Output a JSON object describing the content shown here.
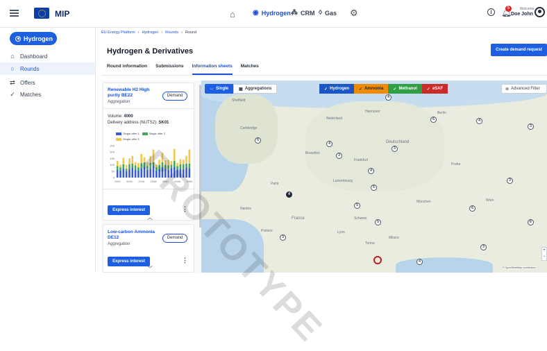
{
  "app": {
    "brand": "MIP"
  },
  "topnav": {
    "items": [
      {
        "label": "Hydrogen",
        "active": true
      },
      {
        "label": "CRM",
        "active": false
      },
      {
        "label": "Gas",
        "active": false
      }
    ],
    "notifications_count": "5",
    "welcome": "Welcome",
    "user_name": "Doe John"
  },
  "sidebar": {
    "sector": "Hydrogen",
    "items": [
      {
        "label": "Dashboard"
      },
      {
        "label": "Rounds"
      },
      {
        "label": "Offers"
      },
      {
        "label": "Matches"
      }
    ]
  },
  "breadcrumb": [
    "EU Energy Platform",
    "Hydrogen",
    "Rounds",
    "Round"
  ],
  "page": {
    "title": "Hydrogen & Derivatives",
    "create_button": "Create demand request",
    "tabs": [
      "Round information",
      "Submissions",
      "Information sheets",
      "Matches"
    ],
    "active_tab": "Information sheets"
  },
  "cards": [
    {
      "title": "Renewable H2 High purity BE22",
      "type": "Aggregation",
      "badge": "Demand",
      "volume_label": "Volume:",
      "volume_value": "4000",
      "delivery_label": "Delivery address (NUTS2):",
      "delivery_value": "SK01",
      "express_label": "Express interest"
    },
    {
      "title": "Low-carbon Ammonia DE12",
      "type": "Aggregation",
      "badge": "Demand",
      "express_label": "Express interest"
    }
  ],
  "chart_data": {
    "type": "bar",
    "stacked": true,
    "legend": [
      "Single offer 1",
      "Single offer 2",
      "Single offer 3"
    ],
    "colors": [
      "#3b5bd6",
      "#3fa85a",
      "#f2c94c"
    ],
    "x_tick_labels": [
      "2026",
      "2030",
      "2034",
      "2038",
      "2042",
      "2046",
      "2050"
    ],
    "y_tick_labels": [
      "250",
      "200",
      "150",
      "100",
      "50",
      "0"
    ],
    "ylim": [
      0,
      250
    ],
    "categories": [
      "2026",
      "2027",
      "2028",
      "2029",
      "2030",
      "2031",
      "2032",
      "2033",
      "2034",
      "2035",
      "2036",
      "2037",
      "2038",
      "2039",
      "2040",
      "2041",
      "2042",
      "2043",
      "2044",
      "2045",
      "2046",
      "2047",
      "2048",
      "2049",
      "2050"
    ],
    "series": [
      {
        "name": "Single offer 1",
        "values": [
          60,
          55,
          70,
          50,
          65,
          80,
          60,
          55,
          75,
          85,
          60,
          70,
          90,
          55,
          65,
          80,
          70,
          60,
          75,
          85,
          60,
          70,
          65,
          80,
          75
        ]
      },
      {
        "name": "Single offer 2",
        "values": [
          30,
          25,
          35,
          20,
          40,
          30,
          35,
          25,
          40,
          35,
          30,
          45,
          30,
          25,
          35,
          40,
          30,
          35,
          25,
          45,
          30,
          35,
          40,
          30,
          35
        ]
      },
      {
        "name": "Single offer 3",
        "values": [
          40,
          20,
          50,
          30,
          45,
          60,
          25,
          35,
          70,
          40,
          30,
          55,
          100,
          20,
          40,
          75,
          35,
          45,
          30,
          95,
          25,
          40,
          35,
          60,
          110
        ]
      }
    ]
  },
  "map": {
    "modes": [
      "Single",
      "Aggregations"
    ],
    "filters": [
      {
        "label": "Hydrogen",
        "color": "#1a56c4"
      },
      {
        "label": "Ammonia",
        "color": "#f08c00"
      },
      {
        "label": "Methanol",
        "color": "#2f9e44"
      },
      {
        "label": "eSAF",
        "color": "#c92a2a"
      }
    ],
    "advanced_filter": "Advanced Filter",
    "attribution": "© OpenStreetMap contributors",
    "zoom_in": "+",
    "zoom_out": "−",
    "labels": [
      "Sheffield",
      "Cambridge",
      "Bruxelles",
      "Paris",
      "Hannover",
      "Berlin",
      "Praha",
      "Frankfurt",
      "München",
      "Wien",
      "Schweiz",
      "Lyon",
      "Milano",
      "Nantes",
      "Torino",
      "Deutschland",
      "France",
      "Poitiers",
      "Nederland",
      "Luxembourg"
    ],
    "pins": [
      "4",
      "6",
      "4",
      "6",
      "3",
      "3",
      "4",
      "5",
      "4",
      "3",
      "4",
      "6",
      "5",
      "3",
      "5",
      "4",
      "3",
      "3",
      "6"
    ]
  },
  "watermark": "PROTOTYPE"
}
